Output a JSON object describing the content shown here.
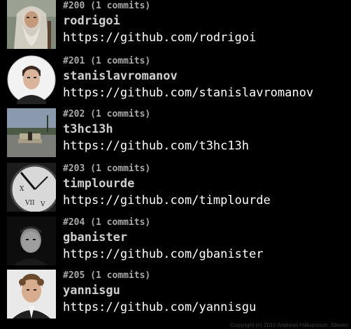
{
  "contributors": [
    {
      "meta": "#200 (1 commits)",
      "username": "rodrigoi",
      "url": "https://github.com/rodrigoi",
      "avatar_icon": "bearded-wizard-avatar"
    },
    {
      "meta": "#201 (1 commits)",
      "username": "stanislavromanov",
      "url": "https://github.com/stanislavromanov",
      "avatar_icon": "portrait-avatar"
    },
    {
      "meta": "#202 (1 commits)",
      "username": "t3hc13h",
      "url": "https://github.com/t3hc13h",
      "avatar_icon": "couch-landscape-avatar"
    },
    {
      "meta": "#203 (1 commits)",
      "username": "timplourde",
      "url": "https://github.com/timplourde",
      "avatar_icon": "clock-avatar"
    },
    {
      "meta": "#204 (1 commits)",
      "username": "gbanister",
      "url": "https://github.com/gbanister",
      "avatar_icon": "dark-portrait-avatar"
    },
    {
      "meta": "#205 (1 commits)",
      "username": "yannisgu",
      "url": "https://github.com/yannisgu",
      "avatar_icon": "curly-hair-portrait-avatar"
    }
  ],
  "footer": {
    "copyright": "Copyright (c) 2010 Andreas Håkansson, Steven"
  }
}
